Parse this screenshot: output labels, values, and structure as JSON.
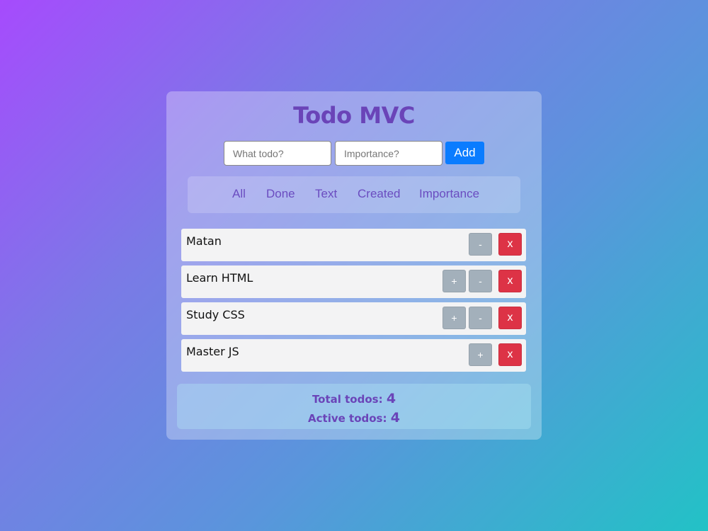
{
  "app": {
    "title": "Todo MVC"
  },
  "form": {
    "todo_placeholder": "What todo?",
    "importance_placeholder": "Importance?",
    "add_label": "Add"
  },
  "filters": [
    "All",
    "Done",
    "Text",
    "Created",
    "Importance"
  ],
  "todos": [
    {
      "text": "Matan",
      "buttons": [
        "-",
        "x"
      ]
    },
    {
      "text": "Learn HTML",
      "buttons": [
        "+",
        "-",
        "x"
      ]
    },
    {
      "text": "Study CSS",
      "buttons": [
        "+",
        "-",
        "x"
      ]
    },
    {
      "text": "Master JS",
      "buttons": [
        "+",
        "x"
      ]
    }
  ],
  "stats": {
    "total_label": "Total todos:",
    "total_value": "4",
    "active_label": "Active todos:",
    "active_value": "4"
  },
  "colors": {
    "accent": "#6a44b8",
    "add_button": "#0a7cff",
    "delete_button": "#dd3346",
    "importance_button": "#a3b0bb"
  }
}
